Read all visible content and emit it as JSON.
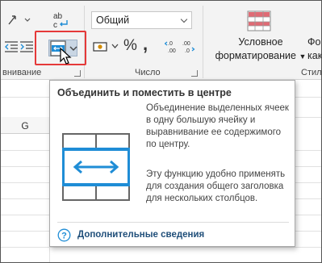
{
  "ribbon": {
    "number_format_value": "Общий",
    "percent_symbol": "%",
    "comma_symbol": ",",
    "conditional_formatting_label_line1": "Условное",
    "conditional_formatting_label_line2": "форматирование",
    "format_as_table_label_line1": "Фор",
    "format_as_table_label_line2": "как",
    "groups": {
      "alignment_partial": "внивание",
      "number": "Число",
      "styles_partial": "Стил"
    },
    "icons": [
      "wrap-text-icon",
      "decrease-indent-icon",
      "increase-indent-icon",
      "merge-and-center-icon",
      "currency-icon",
      "percent-icon",
      "comma-style-icon",
      "increase-decimal-icon",
      "decrease-decimal-icon",
      "conditional-formatting-icon",
      "dialog-launcher-icon"
    ]
  },
  "sheet": {
    "column_header": "G"
  },
  "tooltip": {
    "title": "Объединить и поместить в центре",
    "description": "Объединение выделенных ячеек в одну большую ячейку и выравнивание ее содержимого по центру.",
    "usage": "Эту функцию удобно применять для создания общего заголовка для нескольких столбцов.",
    "help_link": "Дополнительные сведения"
  },
  "colors": {
    "highlight_border": "#e53939",
    "merge_blue": "#1f8dd6",
    "link_blue": "#1f4e79"
  }
}
